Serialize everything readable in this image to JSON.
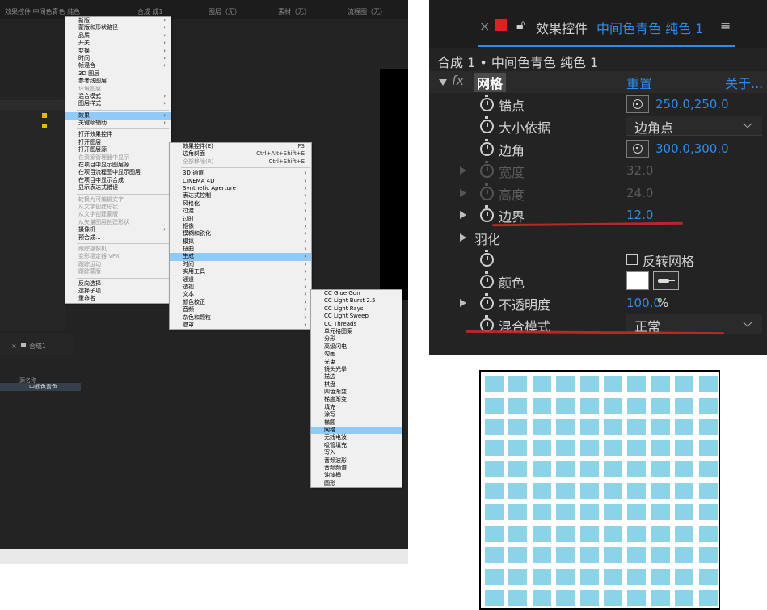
{
  "left": {
    "topbar": {
      "title": "效果控件 中间色青色 纯色",
      "comp_tab": "合成 成1",
      "layer_tab": "图层（无）",
      "footage_tab": "素材（无）",
      "flow_tab": "流程图（无）"
    },
    "timeline": {
      "tab_label": "合成1",
      "col_header": "源名称",
      "layer_name": "中间色青色"
    },
    "context_menu": [
      {
        "label": "新版",
        "arrow": true
      },
      {
        "label": "蒙版和形状路径",
        "arrow": true
      },
      {
        "label": "品质",
        "arrow": true
      },
      {
        "label": "开关",
        "arrow": true
      },
      {
        "label": "变换",
        "arrow": true
      },
      {
        "label": "时间",
        "arrow": true
      },
      {
        "label": "帧混合",
        "arrow": true
      },
      {
        "label": "3D 图层"
      },
      {
        "label": "参考线图层"
      },
      {
        "label": "环境图层",
        "disabled": true
      },
      {
        "label": "混合模式",
        "arrow": true
      },
      {
        "label": "图层样式",
        "arrow": true,
        "sep_after": true
      },
      {
        "label": "效果",
        "arrow": true,
        "highlight": true
      },
      {
        "label": "关键帧辅助",
        "arrow": true,
        "sep_after": true
      },
      {
        "label": "打开效果控件"
      },
      {
        "label": "打开图层"
      },
      {
        "label": "打开图层源"
      },
      {
        "label": "在资源管理器中显示",
        "disabled": true
      },
      {
        "label": "在项目中显示图层源"
      },
      {
        "label": "在项目流程图中显示图层"
      },
      {
        "label": "在项目中显示合成"
      },
      {
        "label": "显示表达式错误",
        "sep_after": true
      },
      {
        "label": "转换为可编辑文字",
        "disabled": true
      },
      {
        "label": "从文字创建形状",
        "disabled": true
      },
      {
        "label": "从文字创建蒙版",
        "disabled": true
      },
      {
        "label": "从矢量图层创建形状",
        "disabled": true
      },
      {
        "label": "摄像机",
        "arrow": true
      },
      {
        "label": "预合成...",
        "sep_after": true
      },
      {
        "label": "跟踪摄像机",
        "disabled": true
      },
      {
        "label": "变形稳定器 VFX",
        "disabled": true
      },
      {
        "label": "跟踪运动",
        "disabled": true
      },
      {
        "label": "跟踪蒙版",
        "disabled": true,
        "sep_after": true
      },
      {
        "label": "反向选择"
      },
      {
        "label": "选择子项"
      },
      {
        "label": "重命名"
      }
    ],
    "effect_menu": [
      {
        "label": "效果控件(E)",
        "shortcut": "F3"
      },
      {
        "label": "边角斜面",
        "shortcut": "Ctrl+Alt+Shift+E"
      },
      {
        "label": "全部移除(R)",
        "shortcut": "Ctrl+Shift+E",
        "disabled": true,
        "sep_after": true
      },
      {
        "label": "3D 通道",
        "arrow": true
      },
      {
        "label": "CINEMA 4D",
        "arrow": true
      },
      {
        "label": "Synthetic Aperture",
        "arrow": true
      },
      {
        "label": "表达式控制",
        "arrow": true
      },
      {
        "label": "风格化",
        "arrow": true
      },
      {
        "label": "过渡",
        "arrow": true
      },
      {
        "label": "过时",
        "arrow": true
      },
      {
        "label": "抠像",
        "arrow": true
      },
      {
        "label": "模糊和锐化",
        "arrow": true
      },
      {
        "label": "模拟",
        "arrow": true
      },
      {
        "label": "扭曲",
        "arrow": true
      },
      {
        "label": "生成",
        "arrow": true,
        "highlight": true
      },
      {
        "label": "时间",
        "arrow": true
      },
      {
        "label": "实用工具",
        "arrow": true
      },
      {
        "label": "通道",
        "arrow": true
      },
      {
        "label": "透视",
        "arrow": true
      },
      {
        "label": "文本",
        "arrow": true
      },
      {
        "label": "颜色校正",
        "arrow": true
      },
      {
        "label": "音频",
        "arrow": true
      },
      {
        "label": "杂色和颗粒",
        "arrow": true
      },
      {
        "label": "遮罩",
        "arrow": true
      }
    ],
    "generate_menu": [
      {
        "label": "CC Glue Gun"
      },
      {
        "label": "CC Light Burst 2.5"
      },
      {
        "label": "CC Light Rays"
      },
      {
        "label": "CC Light Sweep"
      },
      {
        "label": "CC Threads"
      },
      {
        "label": "单元格图案"
      },
      {
        "label": "分形"
      },
      {
        "label": "高级闪电"
      },
      {
        "label": "勾画"
      },
      {
        "label": "光束"
      },
      {
        "label": "镜头光晕"
      },
      {
        "label": "描边"
      },
      {
        "label": "棋盘"
      },
      {
        "label": "四色渐变"
      },
      {
        "label": "梯度渐变"
      },
      {
        "label": "填充"
      },
      {
        "label": "涂写"
      },
      {
        "label": "椭圆"
      },
      {
        "label": "网格",
        "highlight": true
      },
      {
        "label": "无线电波"
      },
      {
        "label": "吸管填充"
      },
      {
        "label": "写入"
      },
      {
        "label": "音频波形"
      },
      {
        "label": "音频频谱"
      },
      {
        "label": "油漆桶"
      },
      {
        "label": "圆形"
      }
    ]
  },
  "effect_panel": {
    "tab_title": "效果控件",
    "tab_layer": "中间色青色 纯色 1",
    "breadcrumb": "合成 1 • 中间色青色 纯色 1",
    "effect_name": "网格",
    "reset_label": "重置",
    "about_label": "关于...",
    "fx_label": "fx",
    "menu_glyph": "≡",
    "props": {
      "anchor": {
        "label": "锚点",
        "value": "250.0,250.0"
      },
      "size_from": {
        "label": "大小依据",
        "value": "边角点"
      },
      "corner": {
        "label": "边角",
        "value": "300.0,300.0"
      },
      "width": {
        "label": "宽度",
        "value": "32.0"
      },
      "height": {
        "label": "高度",
        "value": "24.0"
      },
      "border": {
        "label": "边界",
        "value": "12.0"
      },
      "feather": {
        "label": "羽化"
      },
      "invert": {
        "label": "反转网格",
        "checked": false
      },
      "color": {
        "label": "颜色",
        "value": "#ffffff"
      },
      "opacity": {
        "label": "不透明度",
        "value": "100.0",
        "unit": "%"
      },
      "blend": {
        "label": "混合模式",
        "value": "正常"
      }
    },
    "colors": {
      "accent": "#2d8ceb",
      "label_red": "#e02020",
      "annotation": "#c62828"
    }
  },
  "preview": {
    "cell_color": "#8dd3e7",
    "rows": 11,
    "cols": 10
  }
}
